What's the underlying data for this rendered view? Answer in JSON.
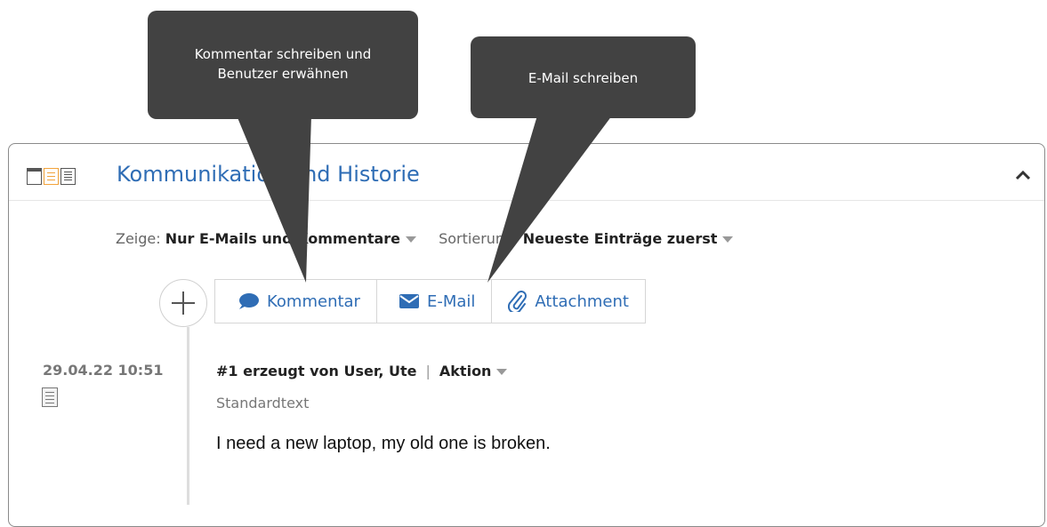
{
  "panel": {
    "title": "Kommunikation und Historie"
  },
  "filters": {
    "show_label": "Zeige:",
    "show_value": "Nur E-Mails und Kommentare",
    "sort_label": "Sortierung:",
    "sort_value": "Neueste Einträge zuerst"
  },
  "actions": {
    "comment": "Kommentar",
    "email": "E-Mail",
    "attachment": "Attachment"
  },
  "entry": {
    "date": "29.04.22 10:51",
    "title": "#1 erzeugt von User, Ute",
    "action": "Aktion",
    "template": "Standardtext",
    "body": "I need a new laptop, my old one is broken."
  },
  "tooltips": {
    "comment_line1": "Kommentar schreiben und",
    "comment_line2": "Benutzer erwähnen",
    "email": "E-Mail schreiben"
  },
  "colors": {
    "accent": "#2f6db5",
    "tooltip_bg": "#424242",
    "active_view": "#f2a33a"
  }
}
